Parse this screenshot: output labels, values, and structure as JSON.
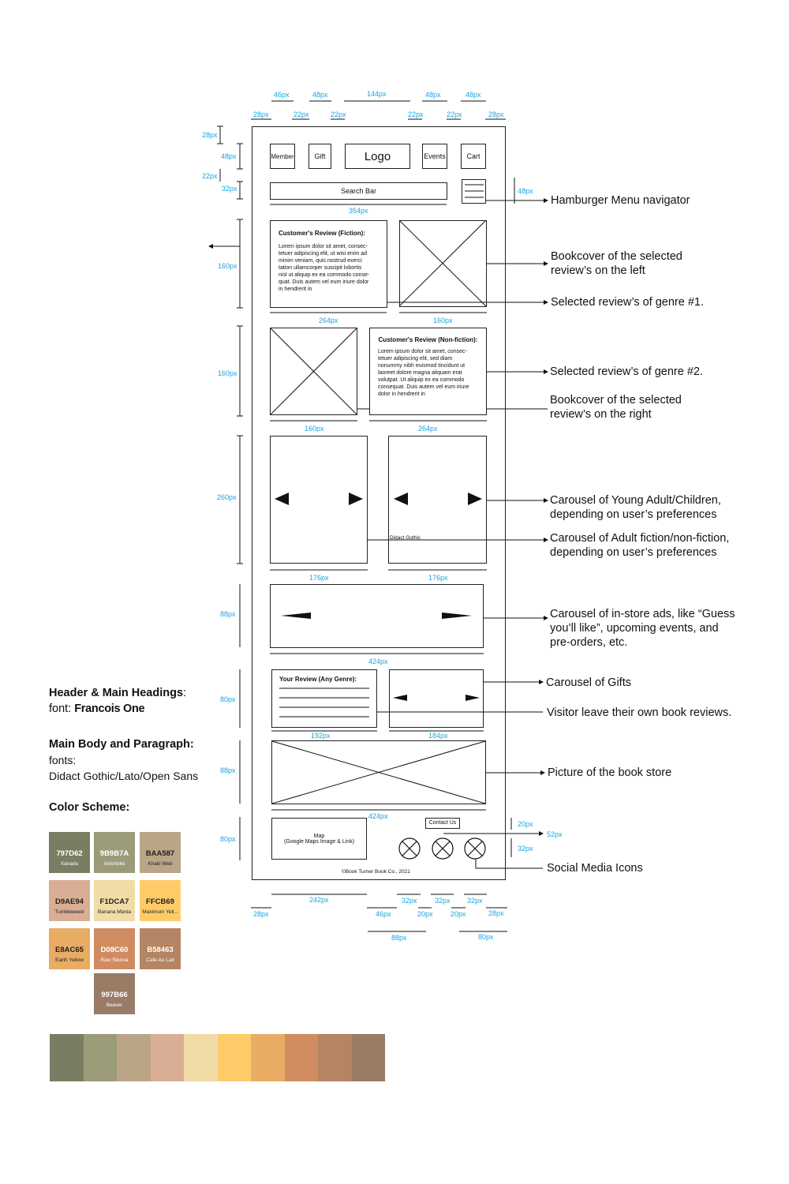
{
  "header": {
    "member": "Member",
    "gift": "Gift",
    "logo": "Logo",
    "events": "Events",
    "cart": "Cart",
    "search": "Search Bar"
  },
  "reviews": {
    "fiction_title": "Customer's Review (Fiction):",
    "nonfiction_title": "Customer's Review (Non-fiction):",
    "fiction_body": "Lorem ipsum dolor sit amet, consec-\ntetuer adipiscing elit, ut wisi enim ad\nminim veniam, quis nostrud exerci\ntation ullamcorper suscipit lobortis\nnisl ut aliquip ex ea commodo conse-\nquat. Duis autem vel eum iriure dolor\nin hendrerit in",
    "nonfiction_body": "Lorem ipsum dolor sit amet, consec-\ntetuer adipiscing elit, sed diam\nnonummy nibh euismod tincidunt ut\nlaoreet dolore magna aliquam erat\nvolutpat. Ut aliquip ex ea commodo\nconsequat. Duis autem vel eum iriure\ndolor in hendrerit in",
    "your_review": "Your Review (Any Genre):"
  },
  "carousel_font_label": "Didact Gothic",
  "footer": {
    "map": "Map\n(Google Maps Image & Link)",
    "contact": "Contact Us",
    "copyright": "©Book Turner Book Co., 2021"
  },
  "dims": {
    "d46px": "46px",
    "d48px": "48px",
    "d144px": "144px",
    "d28px": "28px",
    "d22px": "22px",
    "d32px": "32px",
    "d354px": "354px",
    "d160px": "160px",
    "d264px": "264px",
    "d260px": "260px",
    "d176px": "176px",
    "d88px": "88px",
    "d424px": "424px",
    "d80px": "80px",
    "d192px": "192px",
    "d184px": "184px",
    "d20px": "20px",
    "d52px": "52px",
    "d242px": "242px"
  },
  "annotations": {
    "hamburger": "Hamburger Menu navigator",
    "bookcover_left": "Bookcover of the selected\nreview’s on the left",
    "genre1": "Selected review’s of genre #1.",
    "genre2": "Selected review’s of genre #2.",
    "bookcover_right": "Bookcover of the selected\nreview’s on the right",
    "carousel_ya": "Carousel of Young Adult/Children,\ndepending on user’s preferences",
    "carousel_adult": "Carousel of Adult fiction/non-fiction,\ndepending on user’s preferences",
    "carousel_ads": "Carousel of in-store ads, like “Guess\nyou’ll like”,  upcoming events, and\npre-orders, etc.",
    "carousel_gifts": "Carousel of Gifts",
    "visitor_reviews": "Visitor leave their own book reviews.",
    "store_picture": "Picture of the book store",
    "social": "Social Media Icons"
  },
  "legend": {
    "heading1": "Header & Main Headings",
    "colon": ":",
    "font_label": "font: ",
    "font_name": "Francois One",
    "heading2": "Main Body and Paragraph:",
    "fonts_label": "fonts:",
    "fonts_value": "Didact Gothic/Lato/Open Sans",
    "heading3": "Color Scheme:"
  },
  "colors": [
    {
      "hex": "797D62",
      "name": "Xanadu",
      "color": "#797D62",
      "text_color": "#ffffff"
    },
    {
      "hex": "9B9B7A",
      "name": "Artichoke",
      "color": "#9B9B7A",
      "text_color": "#ffffff"
    },
    {
      "hex": "BAA587",
      "name": "Khaki Web",
      "color": "#BAA587",
      "text_color": "#222222"
    },
    {
      "hex": "D9AE94",
      "name": "Tumbleweed",
      "color": "#D9AE94",
      "text_color": "#222222"
    },
    {
      "hex": "F1DCA7",
      "name": "Banana Mania",
      "color": "#F1DCA7",
      "text_color": "#222222"
    },
    {
      "hex": "FFCB69",
      "name": "Maximum Yell...",
      "color": "#FFCB69",
      "text_color": "#222222"
    },
    {
      "hex": "E8AC65",
      "name": "Earth Yellow",
      "color": "#E8AC65",
      "text_color": "#222222"
    },
    {
      "hex": "D08C60",
      "name": "Raw Sienna",
      "color": "#D08C60",
      "text_color": "#ffffff"
    },
    {
      "hex": "B58463",
      "name": "Cafe Au Lait",
      "color": "#B58463",
      "text_color": "#ffffff"
    },
    {
      "hex": "997B66",
      "name": "Beaver",
      "color": "#997B66",
      "text_color": "#ffffff"
    }
  ]
}
